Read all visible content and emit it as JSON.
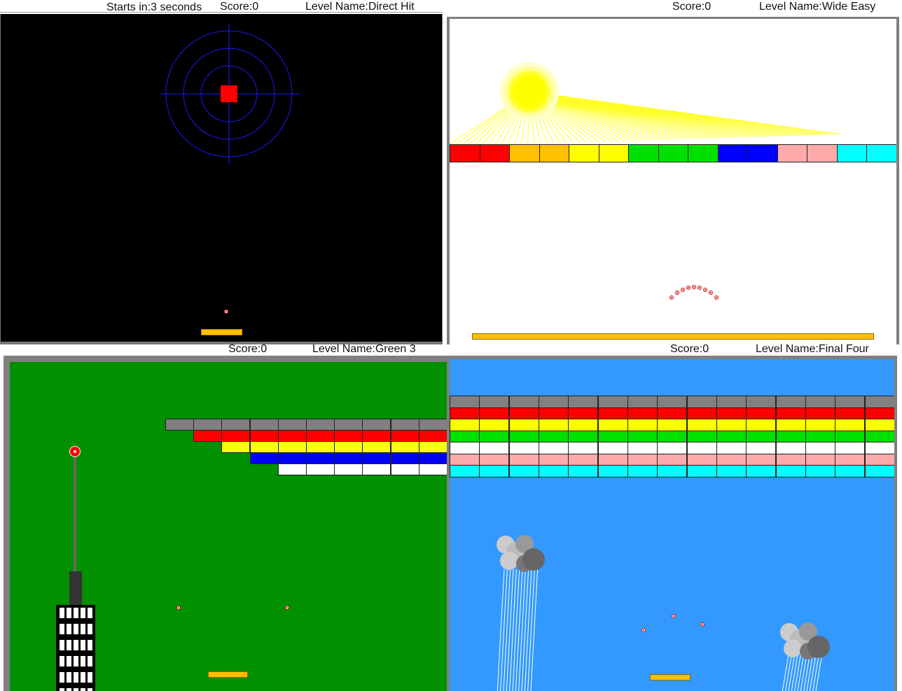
{
  "game1": {
    "countdown": "Starts in:3 seconds",
    "score": "Score:0",
    "level": "Level Name:Direct Hit",
    "background": "#000000"
  },
  "game2": {
    "score": "Score:0",
    "level": "Level Name:Wide Easy",
    "background": "#ffffff",
    "brick_colors": [
      "#ff0000",
      "#ff0000",
      "#ffc000",
      "#ffc000",
      "#ffff00",
      "#ffff00",
      "#00e000",
      "#00e000",
      "#00e000",
      "#0000ff",
      "#0000ff",
      "#ffaaaa",
      "#ffaaaa",
      "#00ffff",
      "#00ffff"
    ]
  },
  "game3": {
    "score": "Score:0",
    "level": "Level Name:Green 3",
    "background": "#009000",
    "rows": [
      {
        "color": "#808080",
        "count": 10
      },
      {
        "color": "#ff0000",
        "count": 9
      },
      {
        "color": "#ffff00",
        "count": 8
      },
      {
        "color": "#0000ff",
        "count": 7
      },
      {
        "color": "#ffffff",
        "count": 6
      }
    ]
  },
  "game4": {
    "score": "Score:0",
    "level": "Level Name:Final Four",
    "background": "#3399ff",
    "rows": [
      "#808080",
      "#ff0000",
      "#ffff00",
      "#00e000",
      "#ffffff",
      "#ffaaaa",
      "#00ffff"
    ],
    "columns": 15
  },
  "colors": {
    "paddle": "#ffc000",
    "wall": "#808080"
  }
}
